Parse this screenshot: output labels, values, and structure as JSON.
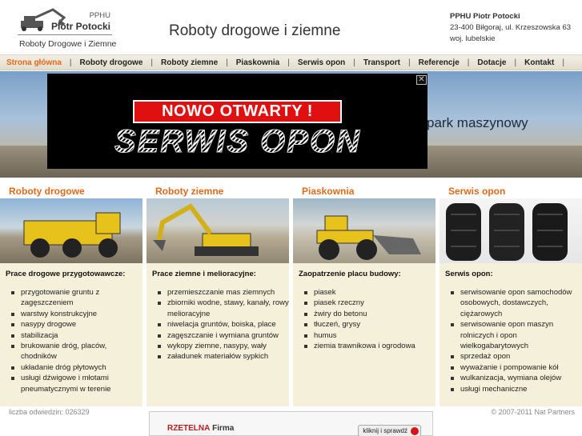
{
  "header": {
    "logo": {
      "top": "PPHU",
      "name": "Piotr Potocki",
      "sub": "Roboty Drogowe i Ziemne"
    },
    "tagline": "Roboty drogowe i ziemne",
    "contact": {
      "name": "PPHU Piotr Potocki",
      "address": "23-400 Biłgoraj, ul. Krzeszowska 63",
      "region": "woj. lubelskie"
    }
  },
  "nav": [
    {
      "label": "Strona główna",
      "active": true
    },
    {
      "label": "Roboty drogowe"
    },
    {
      "label": "Roboty ziemne"
    },
    {
      "label": "Piaskownia"
    },
    {
      "label": "Serwis opon"
    },
    {
      "label": "Transport"
    },
    {
      "label": "Referencje"
    },
    {
      "label": "Dotacje"
    },
    {
      "label": "Kontakt"
    }
  ],
  "hero": {
    "text": "park maszynowy",
    "popup": {
      "headline": "NOWO OTWARTY !",
      "subline": "SERWIS OPON",
      "close": "✕"
    }
  },
  "columns": [
    {
      "title": "Roboty drogowe",
      "subhead": "Prace drogowe przygotowawcze:",
      "items": [
        "przygotowanie gruntu z zagęszczeniem",
        "warstwy konstrukcyjne",
        "nasypy drogowe",
        "stabilizacja",
        "brukowanie dróg, placów, chodników",
        "układanie dróg płytowych",
        "usługi dźwigowe i młotami pneumatycznymi w terenie"
      ]
    },
    {
      "title": "Roboty ziemne",
      "subhead": "Prace ziemne i melioracyjne:",
      "items": [
        "przemieszczanie mas ziemnych",
        "zbiorniki wodne, stawy, kanały, rowy melioracyjne",
        "niwelacja gruntów, boiska, place",
        "zagęszczanie i wymiana gruntów",
        "wykopy ziemne, nasypy, wały",
        "załadunek materiałów sypkich"
      ]
    },
    {
      "title": "Piaskownia",
      "subhead": "Zaopatrzenie placu budowy:",
      "items": [
        "piasek",
        "piasek rzeczny",
        "żwiry do betonu",
        "tłuczeń, grysy",
        "humus",
        "ziemia trawnikowa i ogrodowa"
      ]
    },
    {
      "title": "Serwis opon",
      "subhead": "Serwis opon:",
      "items": [
        "serwisowanie opon samochodów osobowych, dostawczych, ciężarowych",
        "serwisowanie opon maszyn rolniczych i opon wielkogabarytowych",
        "sprzedaż opon",
        "wyważanie i pompowanie kół",
        "wulkanizacja, wymiana olejów",
        "usługi mechaniczne"
      ]
    }
  ],
  "footer": {
    "counter": "liczba odwiedzin: 026329",
    "copyright": "© 2007-2011 Nat Partners",
    "badge": {
      "brand": "RZETELNA",
      "brand2": "Firma",
      "button": "kliknij i sprawdź"
    }
  }
}
